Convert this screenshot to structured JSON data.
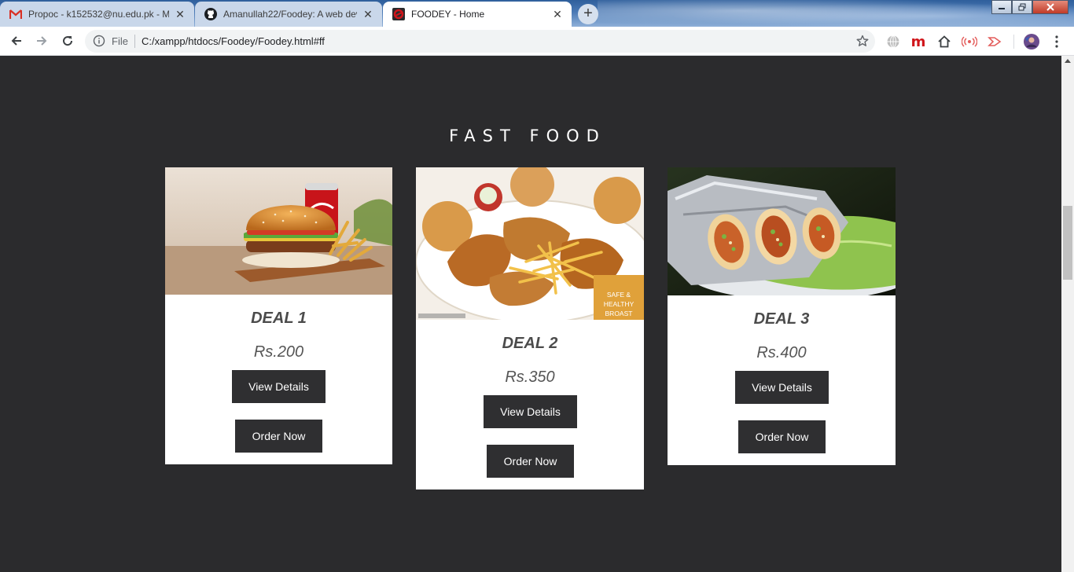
{
  "browser": {
    "tabs": [
      {
        "title": "Propoc - k152532@nu.edu.pk - M",
        "icon": "gmail-icon",
        "active": false
      },
      {
        "title": "Amanullah22/Foodey: A web dev",
        "icon": "github-icon",
        "active": false
      },
      {
        "title": "FOODEY - Home",
        "icon": "foodey-icon",
        "active": true
      }
    ],
    "new_tab_label": "+",
    "address": {
      "scheme_label": "File",
      "url": "C:/xampp/htdocs/Foodey/Foodey.html#ff"
    },
    "extension_m_label": "m"
  },
  "page": {
    "section_title": "FAST FOOD",
    "deals": [
      {
        "name": "DEAL 1",
        "price": "Rs.200",
        "view_label": "View Details",
        "order_label": "Order Now"
      },
      {
        "name": "DEAL 2",
        "price": "Rs.350",
        "view_label": "View Details",
        "order_label": "Order Now",
        "badge": [
          "SAFE &",
          "HEALTHY",
          "BROAST"
        ]
      },
      {
        "name": "DEAL 3",
        "price": "Rs.400",
        "view_label": "View Details",
        "order_label": "Order Now"
      }
    ]
  },
  "colors": {
    "page_bg": "#2b2b2d",
    "card_bg": "#ffffff",
    "button_bg": "#2f2f31",
    "badge_bg": "#e0a13a"
  }
}
